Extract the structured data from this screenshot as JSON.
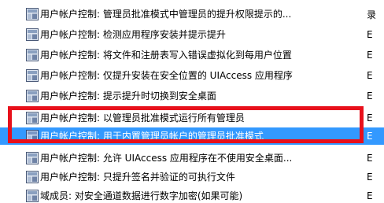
{
  "policies": [
    {
      "name": "用户帐户控制: 管理员批准模式中管理员的提升权限提示的...",
      "setting": "录",
      "icon": "policy-icon",
      "selected": false
    },
    {
      "name": "用户帐户控制: 检测应用程序安装并提示提升",
      "setting": "E",
      "icon": "policy-icon",
      "selected": false
    },
    {
      "name": "用户帐户控制: 将文件和注册表写入错误虚拟化到每用户位置",
      "setting": "E",
      "icon": "policy-icon",
      "selected": false
    },
    {
      "name": "用户帐户控制: 仅提升安装在安全位置的 UIAccess 应用程序",
      "setting": "E",
      "icon": "policy-icon",
      "selected": false
    },
    {
      "name": "用户帐户控制: 提示提升时切换到安全桌面",
      "setting": "E",
      "icon": "policy-icon",
      "selected": false
    },
    {
      "name": "用户帐户控制: 以管理员批准模式运行所有管理员",
      "setting": "E",
      "icon": "policy-icon",
      "selected": false
    },
    {
      "name": "用户帐户控制: 用于内置管理员帐户的管理员批准模式",
      "setting": "E",
      "icon": "policy-icon",
      "selected": true
    },
    {
      "name": "用户帐户控制: 允许 UIAccess 应用程序在不使用安全桌面...",
      "setting": "E",
      "icon": "policy-icon",
      "selected": false
    },
    {
      "name": "用户帐户控制: 只提升签名并验证的可执行文件",
      "setting": "E",
      "icon": "policy-icon",
      "selected": false
    },
    {
      "name": "域成员: 对安全通道数据进行数字加密(如果可能)",
      "setting": "E",
      "icon": "policy-icon",
      "selected": false
    }
  ],
  "colors": {
    "selection": "#3399ff",
    "highlight_border": "#e8101b",
    "icon_frame": "#4a5a78",
    "icon_fill": "#dfe6f0"
  }
}
